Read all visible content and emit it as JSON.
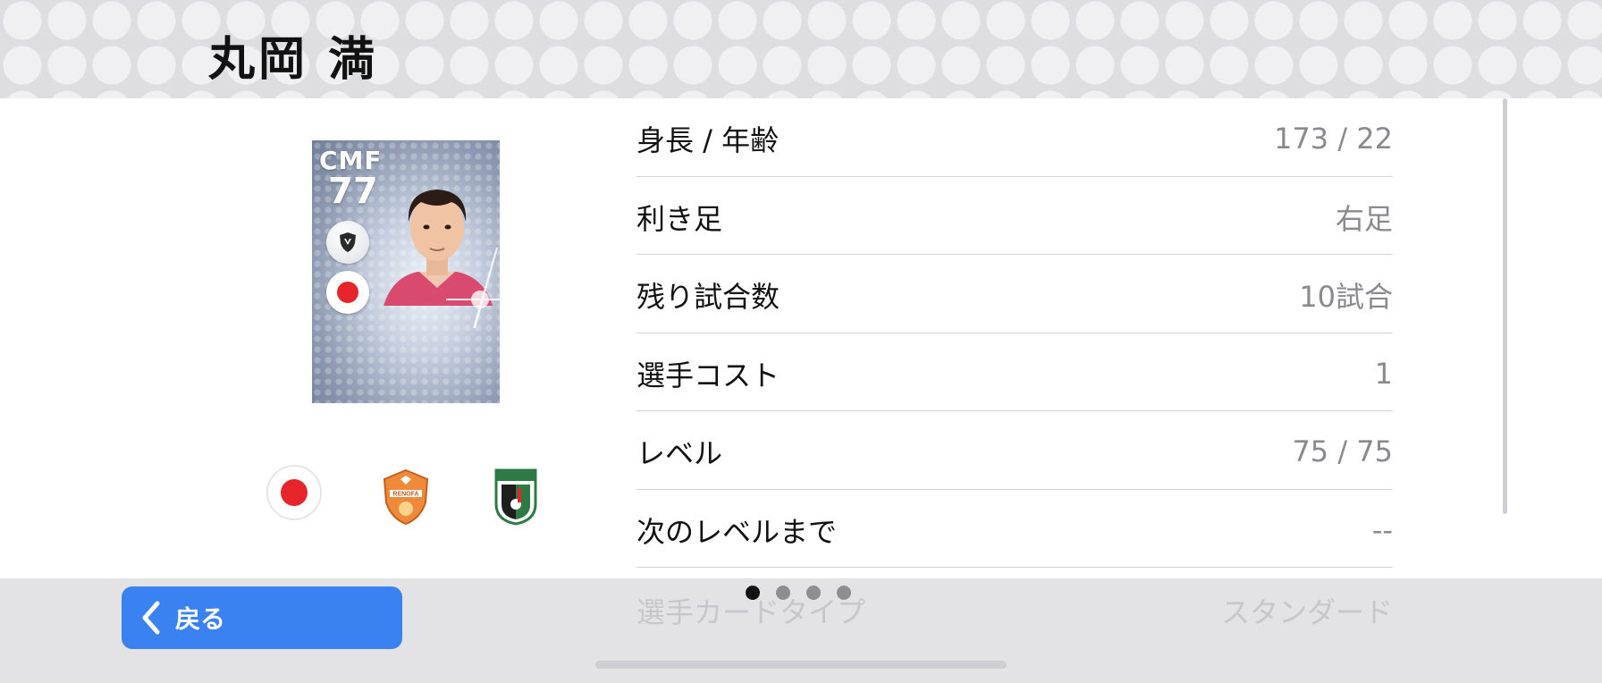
{
  "header": {
    "player_name": "丸岡 満"
  },
  "card": {
    "position": "CMF",
    "rating": "77",
    "emblem_icon": "shield-emblem-icon",
    "flag_icon": "japan-flag-icon",
    "background_color": "#8e9bb2"
  },
  "badges": [
    {
      "name": "japan-flag-icon"
    },
    {
      "name": "renofa-yamaguchi-club-icon",
      "text": "RENOFA"
    },
    {
      "name": "j-league-icon",
      "text": "明治安田生命 J.LEAGUE"
    }
  ],
  "info_rows": [
    {
      "label": "身長 / 年齢",
      "value": "173 / 22"
    },
    {
      "label": "利き足",
      "value": "右足"
    },
    {
      "label": "残り試合数",
      "value": "10試合"
    },
    {
      "label": "選手コスト",
      "value": "1"
    },
    {
      "label": "レベル",
      "value": "75 / 75"
    },
    {
      "label": "次のレベルまで",
      "value": "--"
    }
  ],
  "peek_row": {
    "label": "選手カードタイプ",
    "value": "スタンダード"
  },
  "back_button": {
    "label": "戻る"
  },
  "pagination": {
    "total": 4,
    "active": 1
  },
  "colors": {
    "accent": "#3a82f1",
    "flag_red": "#e5252a"
  }
}
